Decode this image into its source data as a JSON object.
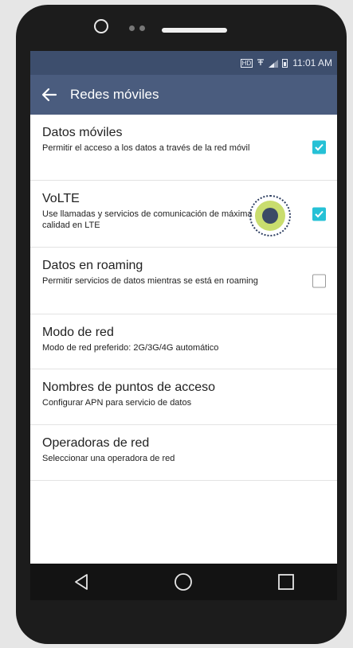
{
  "status_bar": {
    "hd_label": "HD",
    "time": "11:01 AM"
  },
  "app_bar": {
    "title": "Redes móviles",
    "back_icon": "arrow-left-icon"
  },
  "items": [
    {
      "title": "Datos móviles",
      "subtitle": "Permitir el acceso a los datos a través de la red móvil",
      "checkbox": "checked"
    },
    {
      "title": "VoLTE",
      "subtitle": "Use llamadas y servicios de comunicación de máxima calidad en LTE",
      "checkbox": "checked"
    },
    {
      "title": "Datos en roaming",
      "subtitle": "Permitir servicios de datos mientras se está en roaming",
      "checkbox": "unchecked"
    },
    {
      "title": "Modo de red",
      "subtitle": "Modo de red preferido: 2G/3G/4G automático"
    },
    {
      "title": "Nombres de puntos de acceso",
      "subtitle": "Configurar APN para servicio de datos"
    },
    {
      "title": "Operadoras de red",
      "subtitle": "Seleccionar una operadora de red"
    }
  ],
  "colors": {
    "status_bar": "#3d4e6d",
    "app_bar": "#4a5c7e",
    "checkbox_checked": "#26c1d6",
    "touch_highlight": "#c9dd6e"
  },
  "nav": {
    "back": "back-triangle-icon",
    "home": "home-circle-icon",
    "recents": "recents-square-icon"
  }
}
